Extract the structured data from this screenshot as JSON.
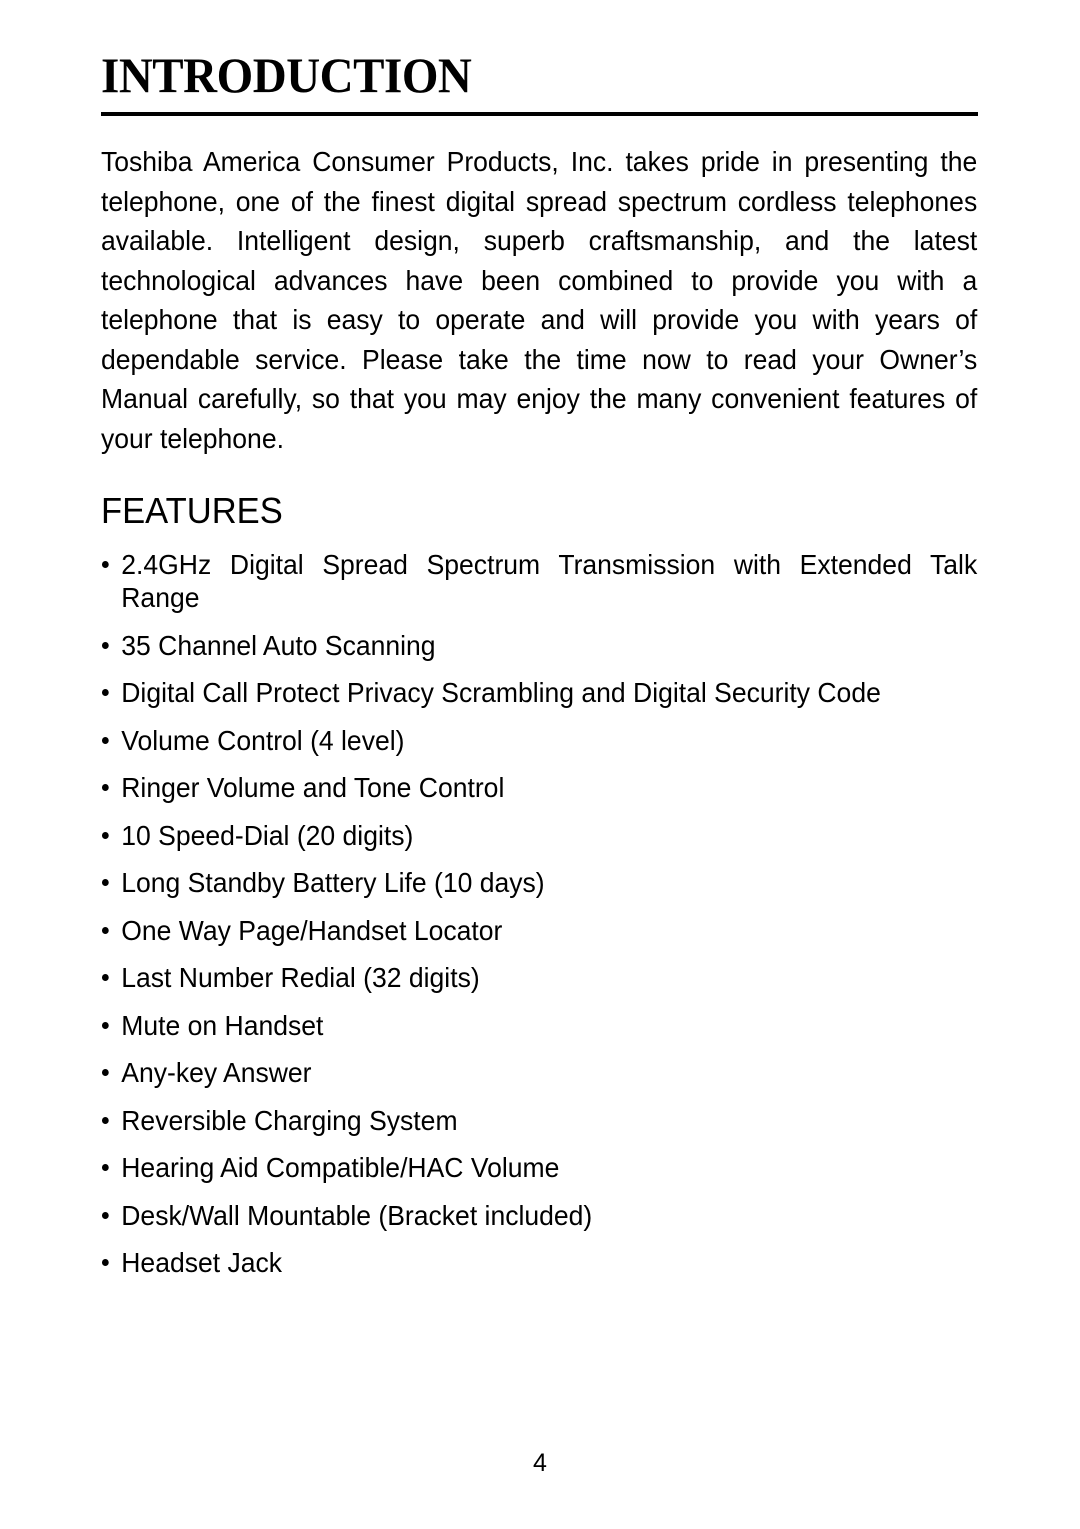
{
  "document": {
    "title": "INTRODUCTION",
    "intro_paragraph": "Toshiba America Consumer Products, Inc. takes pride in presenting the telephone, one of the finest digital spread spectrum cordless telephones available. Intelligent design, superb craftsmanship, and the latest technological advances have been combined to provide you with a telephone that is easy to operate and will provide you with years of dependable service. Please take the time now to read your Owner’s Manual carefully, so that you may enjoy the many convenient features of your telephone.",
    "features_heading": "FEATURES",
    "features": [
      "2.4GHz Digital Spread Spectrum Transmission with Extended Talk Range",
      "35 Channel Auto Scanning",
      "Digital Call Protect Privacy Scrambling and Digital Security Code",
      "Volume Control (4 level)",
      "Ringer Volume and Tone Control",
      "10 Speed-Dial (20 digits)",
      "Long Standby Battery Life (10 days)",
      "One Way Page/Handset Locator",
      "Last Number Redial (32 digits)",
      "Mute on Handset",
      "Any-key Answer",
      "Reversible Charging System",
      "Hearing Aid Compatible/HAC Volume",
      "Desk/Wall Mountable (Bracket included)",
      "Headset Jack"
    ],
    "page_number": "4",
    "colors": {
      "text": "#000000",
      "background": "#ffffff",
      "rule": "#000000"
    }
  }
}
